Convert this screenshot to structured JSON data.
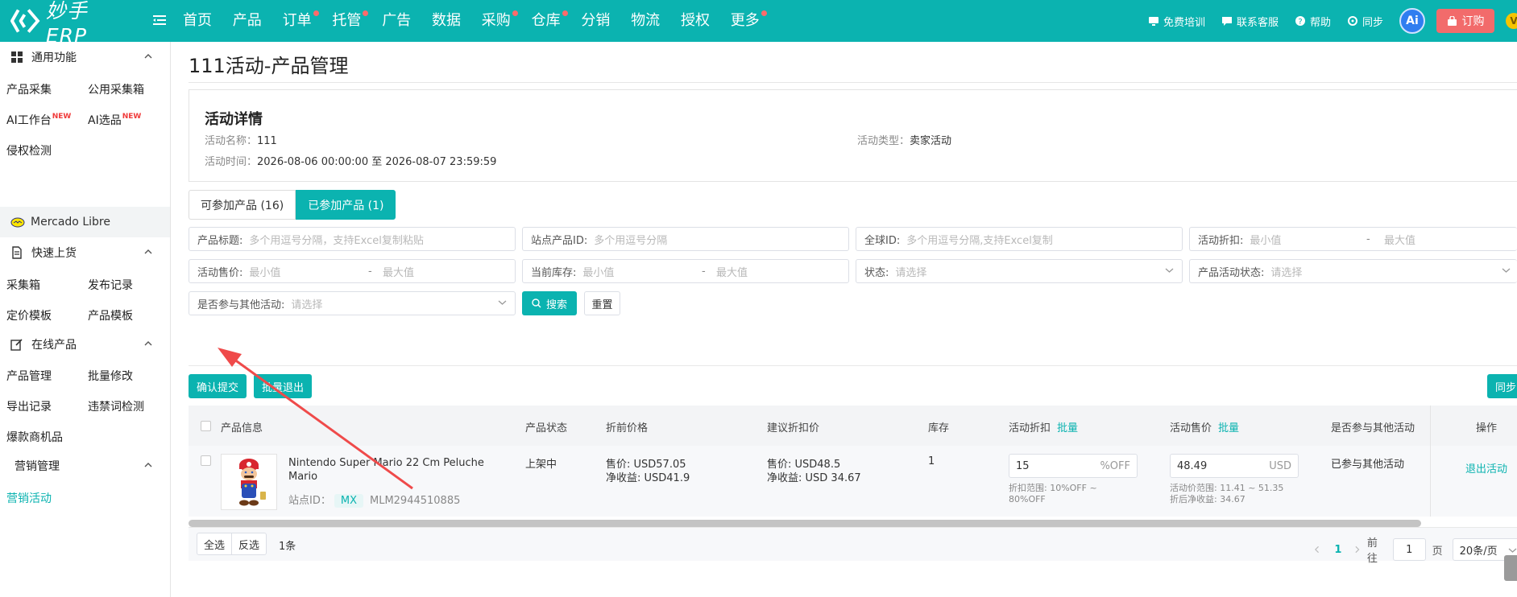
{
  "header": {
    "logo_text": "妙手ERP",
    "nav": [
      {
        "label": "首页",
        "dot": false
      },
      {
        "label": "产品",
        "dot": false
      },
      {
        "label": "订单",
        "dot": true
      },
      {
        "label": "托管",
        "dot": true
      },
      {
        "label": "广告",
        "dot": false
      },
      {
        "label": "数据",
        "dot": false
      },
      {
        "label": "采购",
        "dot": true
      },
      {
        "label": "仓库",
        "dot": true
      },
      {
        "label": "分销",
        "dot": false
      },
      {
        "label": "物流",
        "dot": false
      },
      {
        "label": "授权",
        "dot": false
      },
      {
        "label": "更多",
        "dot": true
      }
    ],
    "right": {
      "training": "免费培训",
      "support": "联系客服",
      "help": "帮助",
      "sync": "同步",
      "ai": "Ai",
      "order": "订购",
      "vip": "V"
    },
    "colors": {
      "primary": "#0bb3b0",
      "dot": "#ff6b6b",
      "order": "#f26b6b"
    }
  },
  "sidebar": {
    "sections": [
      {
        "title": "通用功能",
        "icon": "grid-icon"
      },
      {
        "title": "快速上货",
        "icon": "document-icon"
      },
      {
        "title": "在线产品",
        "icon": "edit-icon"
      },
      {
        "title": "营销管理",
        "icon": ""
      }
    ],
    "links": {
      "collect": "产品采集",
      "public_box": "公用采集箱",
      "ai_workbench": "AI工作台",
      "ai_select": "AI选品",
      "new_badge": "NEW",
      "infringement": "侵权检测",
      "platform": "Mercado Libre",
      "collect_box": "采集箱",
      "publish_log": "发布记录",
      "price_tpl": "定价模板",
      "product_tpl": "产品模板",
      "product_mgmt": "产品管理",
      "bulk_edit": "批量修改",
      "export_log": "导出记录",
      "banned_words": "违禁词检测",
      "hot_products": "爆款商机品",
      "marketing": "营销活动"
    }
  },
  "page": {
    "title": "111活动-产品管理",
    "detail": {
      "heading": "活动详情",
      "name_label": "活动名称：",
      "name_value": "111",
      "type_label": "活动类型：",
      "type_value": "卖家活动",
      "time_label": "活动时间：",
      "time_value": "2026-08-06 00:00:00 至 2026-08-07 23:59:59"
    },
    "tabs": [
      {
        "label": "可参加产品 (16)",
        "active": false
      },
      {
        "label": "已参加产品 (1)",
        "active": true
      }
    ],
    "filters": {
      "title": {
        "label": "产品标题:",
        "placeholder": "多个用逗号分隔，支持Excel复制粘贴"
      },
      "site_id": {
        "label": "站点产品ID:",
        "placeholder": "多个用逗号分隔"
      },
      "global_id": {
        "label": "全球ID:",
        "placeholder": "多个用逗号分隔,支持Excel复制"
      },
      "discount": {
        "label": "活动折扣:",
        "min": "最小值",
        "max": "最大值"
      },
      "price": {
        "label": "活动售价:",
        "min": "最小值",
        "max": "最大值"
      },
      "stock": {
        "label": "当前库存:",
        "min": "最小值",
        "max": "最大值"
      },
      "status": {
        "label": "状态:",
        "placeholder": "请选择"
      },
      "activity_status": {
        "label": "产品活动状态:",
        "placeholder": "请选择"
      },
      "other_activity": {
        "label": "是否参与其他活动:",
        "placeholder": "请选择"
      },
      "dash": "-",
      "search": "搜索",
      "reset": "重置"
    },
    "actions": {
      "confirm": "确认提交",
      "bulk_exit": "批量退出",
      "sync": "同步"
    },
    "table": {
      "headers": {
        "info": "产品信息",
        "status": "产品状态",
        "orig_price": "折前价格",
        "suggest": "建议折扣价",
        "stock": "库存",
        "discount": "活动折扣",
        "price": "活动售价",
        "other": "是否参与其他活动",
        "ops": "操作",
        "bulk": "批量"
      },
      "rows": [
        {
          "title_line1": "Nintendo Super Mario 22 Cm Peluche",
          "title_line2": "Mario",
          "site_label": "站点ID：",
          "site_code": "MX",
          "site_id": "MLM2944510885",
          "status": "上架中",
          "orig_sale": "售价: USD57.05",
          "orig_net": "净收益: USD41.9",
          "sugg_sale": "售价: USD48.5",
          "sugg_net": "净收益: USD 34.67",
          "stock": "1",
          "discount_value": "15",
          "discount_suffix": "%OFF",
          "discount_range_1": "折扣范围: 10%OFF ~",
          "discount_range_2": "80%OFF",
          "price_value": "48.49",
          "price_suffix": "USD",
          "price_range": "活动价范围: 11.41 ~ 51.35",
          "price_net": "折后净收益: 34.67",
          "other": "已参与其他活动",
          "op": "退出活动"
        }
      ]
    },
    "footer": {
      "select_all": "全选",
      "invert": "反选",
      "count": "1条",
      "page": "1",
      "goto": "前往",
      "goto_value": "1",
      "page_unit": "页",
      "page_size": "20条/页"
    }
  }
}
